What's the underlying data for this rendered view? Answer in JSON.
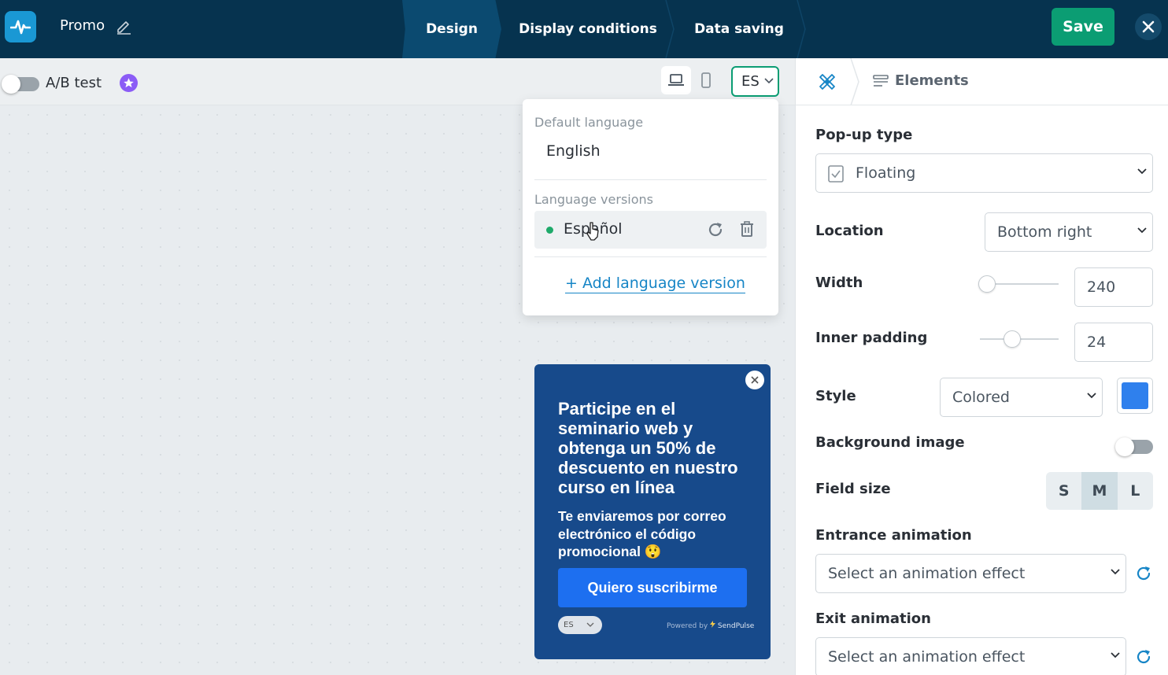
{
  "header": {
    "title": "Promo",
    "steps": [
      "Design",
      "Display conditions",
      "Data saving"
    ],
    "save_label": "Save"
  },
  "toolbar": {
    "ab_test_label": "A/B test",
    "ab_test_enabled": false,
    "language_code": "ES"
  },
  "language_menu": {
    "default_caption": "Default language",
    "default_value": "English",
    "versions_caption": "Language versions",
    "versions": [
      {
        "label": "Español",
        "status_color": "#1eaa6a"
      }
    ],
    "add_label": "+ Add language version"
  },
  "popup_preview": {
    "title": "Participe en el seminario web y obtenga un 50% de descuento en nuestro curso en línea",
    "text": "Te enviaremos por correo electrónico el código promocional 😲",
    "button_label": "Quiero suscribirme",
    "language": "ES",
    "powered_by": "Powered by",
    "brand": "SendPulse",
    "background_color": "#174a8b",
    "button_color": "#1d6ff0"
  },
  "panel": {
    "elements_tab": "Elements",
    "popup_type_label": "Pop-up type",
    "popup_type_value": "Floating",
    "location_label": "Location",
    "location_value": "Bottom right",
    "width_label": "Width",
    "width_value": "240",
    "inner_padding_label": "Inner padding",
    "inner_padding_value": "24",
    "style_label": "Style",
    "style_value": "Colored",
    "style_color": "#2f80ed",
    "background_image_label": "Background image",
    "background_image_enabled": false,
    "field_size_label": "Field size",
    "field_sizes": [
      "S",
      "M",
      "L"
    ],
    "field_size_selected": "M",
    "entrance_label": "Entrance animation",
    "entrance_value": "Select an animation effect",
    "exit_label": "Exit animation",
    "exit_value": "Select an animation effect"
  },
  "colors": {
    "topbar": "#06334f",
    "accent_green": "#0b9d73",
    "link_blue": "#1685c6"
  }
}
